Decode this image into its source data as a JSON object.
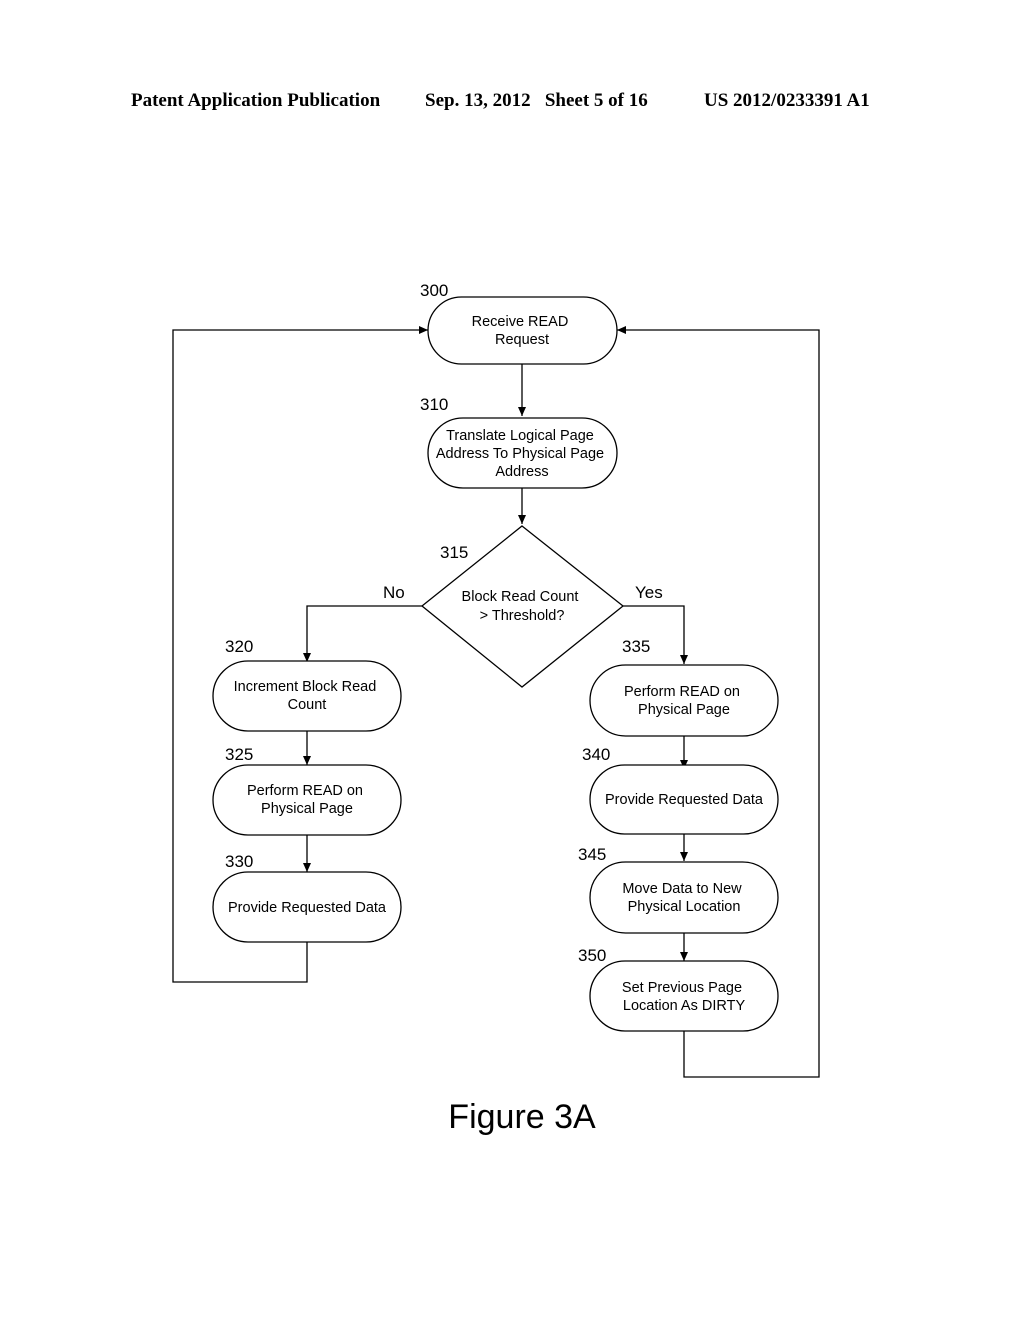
{
  "header": {
    "publication": "Patent Application Publication",
    "date_sheet": "Sep. 13, 2012   Sheet 5 of 16",
    "number": "US 2012/0233391 A1"
  },
  "figure": {
    "caption": "Figure 3A",
    "nodes": {
      "n300": {
        "ref": "300",
        "lines": [
          "Receive READ",
          "Request"
        ]
      },
      "n310": {
        "ref": "310",
        "lines": [
          "Translate Logical Page",
          "Address To Physical Page",
          "Address"
        ]
      },
      "n315": {
        "ref": "315",
        "lines": [
          "Block Read Count",
          "> Threshold?"
        ]
      },
      "n320": {
        "ref": "320",
        "lines": [
          "Increment Block Read",
          "Count"
        ]
      },
      "n325": {
        "ref": "325",
        "lines": [
          "Perform READ on",
          "Physical Page"
        ]
      },
      "n330": {
        "ref": "330",
        "lines": [
          "Provide Requested Data"
        ]
      },
      "n335": {
        "ref": "335",
        "lines": [
          "Perform READ on",
          "Physical Page"
        ]
      },
      "n340": {
        "ref": "340",
        "lines": [
          "Provide Requested Data"
        ]
      },
      "n345": {
        "ref": "345",
        "lines": [
          "Move Data to New",
          "Physical Location"
        ]
      },
      "n350": {
        "ref": "350",
        "lines": [
          "Set Previous Page",
          "Location As DIRTY"
        ]
      }
    },
    "branches": {
      "no": "No",
      "yes": "Yes"
    }
  }
}
